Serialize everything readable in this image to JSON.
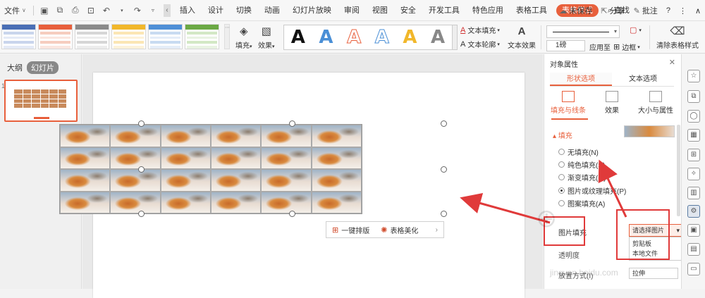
{
  "menubar": {
    "file_label": "文件",
    "tabs": [
      "插入",
      "设计",
      "切换",
      "动画",
      "幻灯片放映",
      "审阅",
      "视图",
      "安全",
      "开发工具",
      "特色应用",
      "表格工具"
    ],
    "active_tab": "表格样式",
    "search": "查找",
    "unsaved": "未保存",
    "share": "分享",
    "comment": "批注",
    "help": "?"
  },
  "ribbon": {
    "fill": "填充",
    "effect": "效果",
    "textart_letters": [
      "A",
      "A",
      "A",
      "A",
      "A",
      "A"
    ],
    "text_fill": "文本填充",
    "text_outline": "文本轮廓",
    "text_effect": "文本效果",
    "line_weight": "1磅",
    "apply_to": "应用至",
    "border": "边框",
    "clear_style": "清除表格样式"
  },
  "leftpane": {
    "outline_tab": "大纲",
    "slides_tab": "幻灯片",
    "slide_number": "1"
  },
  "floatbar": {
    "layout": "一键排版",
    "beautify": "表格美化",
    "more": "›"
  },
  "panel": {
    "title": "对象属性",
    "tab_shape": "形状选项",
    "tab_text": "文本选项",
    "sub_fill_line": "填充与线条",
    "sub_effect": "效果",
    "sub_size": "大小与属性",
    "fill_section": "填充",
    "options": [
      "无填充(N)",
      "纯色填充(S)",
      "渐变填充(G)",
      "图片或纹理填充(P)",
      "图案填充(A)"
    ],
    "picture_fill_label": "图片填充",
    "select_picture": "请选择图片",
    "dropdown_items": [
      "剪贴板",
      "本地文件"
    ],
    "row_transparency": "透明度",
    "row_offset": "放置方式(I)",
    "row_offset_value": "拉伸"
  },
  "watermark": "jingyan.baidu.com",
  "colors": {
    "accent": "#e8603c",
    "annotation": "#e03a3a"
  }
}
